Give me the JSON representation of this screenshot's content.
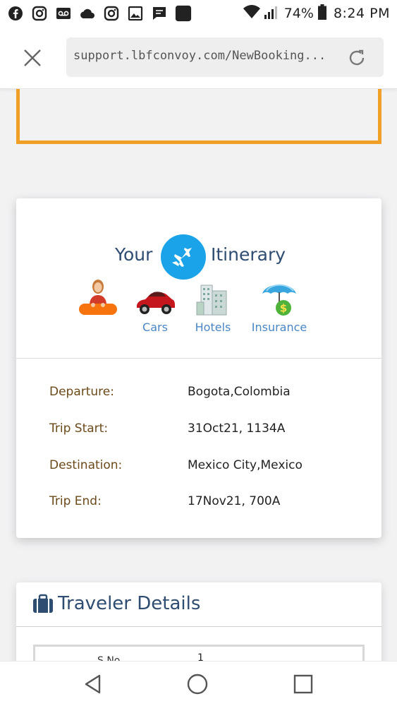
{
  "status_bar": {
    "battery": "74%",
    "time": "8:24 PM",
    "icons": [
      "facebook-icon",
      "instagram-icon",
      "voicemail-icon",
      "cloud-icon",
      "instagram-icon",
      "gallery-icon",
      "message-icon",
      "app-icon",
      "wifi-icon",
      "signal-icon",
      "battery-icon"
    ]
  },
  "browser": {
    "url": "support.lbfconvoy.com/NewBooking..."
  },
  "itinerary": {
    "title_left": "Your",
    "title_right": "Itinerary",
    "tabs": [
      {
        "label": "",
        "icon": "agent-person-icon"
      },
      {
        "label": "Cars",
        "icon": "car-icon"
      },
      {
        "label": "Hotels",
        "icon": "hotel-icon"
      },
      {
        "label": "Insurance",
        "icon": "insurance-umbrella-icon"
      }
    ],
    "rows": [
      {
        "label": "Departure:",
        "value": "Bogota,Colombia"
      },
      {
        "label": "Trip Start:",
        "value": "31Oct21, 1134A"
      },
      {
        "label": "Destination:",
        "value": "Mexico City,Mexico"
      },
      {
        "label": "Trip End:",
        "value": "17Nov21, 700A"
      }
    ]
  },
  "traveler": {
    "title": "Traveler Details",
    "column_header": "S.No",
    "first_value": "1"
  },
  "colors": {
    "heading": "#2f4c71",
    "link": "#4a86c5",
    "label": "#6b4a1a",
    "accent_orange": "#f0a026",
    "plane_blue": "#1aa3e8"
  }
}
